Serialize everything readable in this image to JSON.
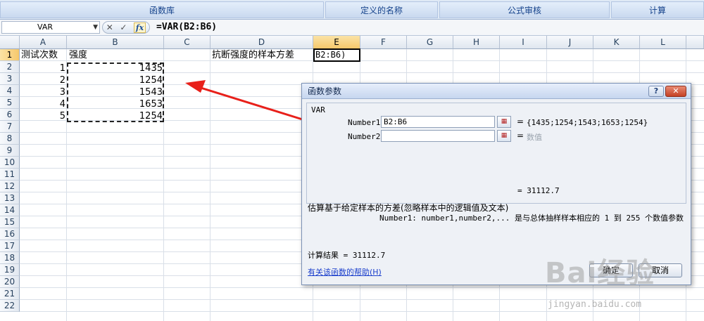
{
  "ribbon": {
    "groups": [
      "函数库",
      "定义的名称",
      "公式审核",
      "计算"
    ]
  },
  "formula_bar": {
    "name_box": "VAR",
    "formula": "=VAR(B2:B6)",
    "cancel_glyph": "✕",
    "enter_glyph": "✓",
    "fx_label": "fx"
  },
  "sheet": {
    "columns": [
      "A",
      "B",
      "C",
      "D",
      "E",
      "F",
      "G",
      "H",
      "I",
      "J",
      "K",
      "L"
    ],
    "selected_column": "E",
    "rows": [
      "1",
      "2",
      "3",
      "4",
      "5",
      "6",
      "7",
      "8",
      "9",
      "10",
      "11",
      "12",
      "13",
      "14",
      "15",
      "16",
      "17",
      "18",
      "19",
      "20",
      "21",
      "22"
    ],
    "selected_row": "1",
    "cells": {
      "A1": "测试次数",
      "B1": "强度",
      "D1": "抗断强度的样本方差",
      "A2": "1",
      "A3": "2",
      "A4": "3",
      "A5": "4",
      "A6": "5",
      "B2": "1435",
      "B3": "1254",
      "B4": "1543",
      "B5": "1653",
      "B6": "1254"
    },
    "active_cell_text": "B2:B6)"
  },
  "dialog": {
    "title": "函数参数",
    "help_button": "?",
    "close_button": "✕",
    "function_name": "VAR",
    "args": [
      {
        "label": "Number1",
        "value": "B2:B6",
        "result": "{1435;1254;1543;1653;1254}"
      },
      {
        "label": "Number2",
        "value": "",
        "result": "数值"
      }
    ],
    "equals": "=",
    "preview": "= 31112.7",
    "description": "估算基于给定样本的方差(忽略样本中的逻辑值及文本)",
    "arg_help": "Number1:  number1,number2,... 是与总体抽样样本相应的 1 到 255 个数值参数",
    "result": "计算结果 =  31112.7",
    "help_link": "有关该函数的帮助(H)",
    "ok_label": "确定",
    "cancel_label": "取消"
  },
  "annotation": {
    "arrow_color": "#e8201a"
  },
  "watermark": {
    "logo": "Bai经验",
    "url": "jingyan.baidu.com"
  }
}
